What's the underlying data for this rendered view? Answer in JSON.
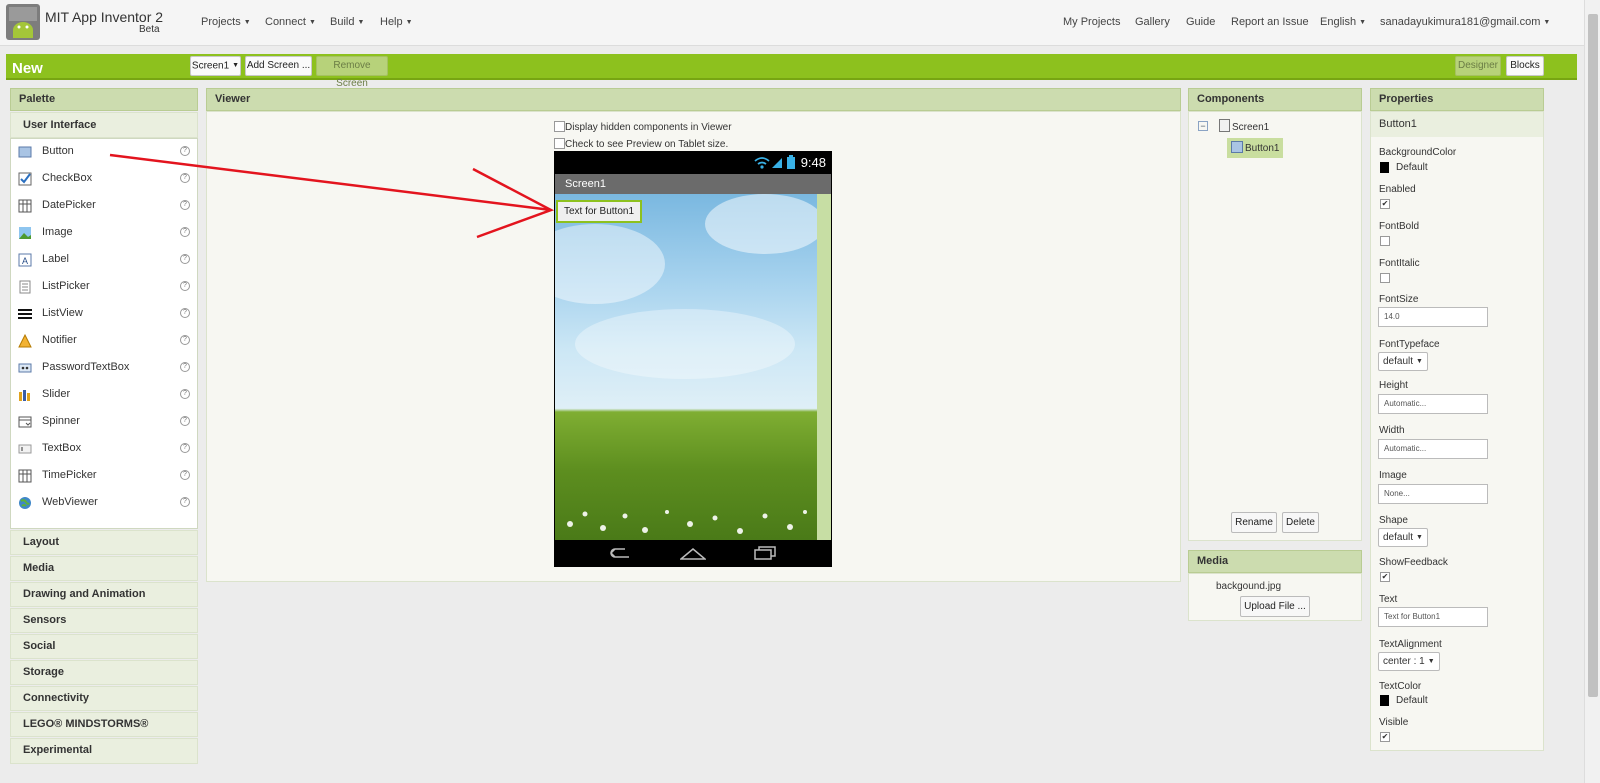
{
  "header": {
    "app_title": "MIT App Inventor 2",
    "app_subtitle": "Beta",
    "left_menu": [
      {
        "label": "Projects"
      },
      {
        "label": "Connect"
      },
      {
        "label": "Build"
      },
      {
        "label": "Help"
      }
    ],
    "right_menu": {
      "my_projects": "My Projects",
      "gallery": "Gallery",
      "guide": "Guide",
      "report": "Report an Issue",
      "language": "English",
      "account": "sanadayukimura181@gmail.com"
    }
  },
  "toolbar": {
    "project_name": "New",
    "screen_select": "Screen1",
    "add_screen": "Add Screen ...",
    "remove_screen": "Remove Screen",
    "designer": "Designer",
    "blocks": "Blocks"
  },
  "palette": {
    "title": "Palette",
    "open_category": "User Interface",
    "items": [
      {
        "label": "Button",
        "icon": "button-icon"
      },
      {
        "label": "CheckBox",
        "icon": "checkbox-icon"
      },
      {
        "label": "DatePicker",
        "icon": "datepicker-icon"
      },
      {
        "label": "Image",
        "icon": "image-icon"
      },
      {
        "label": "Label",
        "icon": "label-icon"
      },
      {
        "label": "ListPicker",
        "icon": "listpicker-icon"
      },
      {
        "label": "ListView",
        "icon": "listview-icon"
      },
      {
        "label": "Notifier",
        "icon": "notifier-icon"
      },
      {
        "label": "PasswordTextBox",
        "icon": "password-icon"
      },
      {
        "label": "Slider",
        "icon": "slider-icon"
      },
      {
        "label": "Spinner",
        "icon": "spinner-icon"
      },
      {
        "label": "TextBox",
        "icon": "textbox-icon"
      },
      {
        "label": "TimePicker",
        "icon": "timepicker-icon"
      },
      {
        "label": "WebViewer",
        "icon": "webviewer-icon"
      }
    ],
    "help_glyph": "?",
    "categories": [
      "Layout",
      "Media",
      "Drawing and Animation",
      "Sensors",
      "Social",
      "Storage",
      "Connectivity",
      "LEGO® MINDSTORMS®",
      "Experimental"
    ]
  },
  "viewer": {
    "title": "Viewer",
    "display_hidden": "Display hidden components in Viewer",
    "tablet_preview": "Check to see Preview on Tablet size.",
    "clock": "9:48",
    "screen_title": "Screen1",
    "button_text": "Text for Button1"
  },
  "components": {
    "title": "Components",
    "tree": {
      "screen": "Screen1",
      "child": "Button1"
    },
    "collapse_glyph": "−",
    "rename": "Rename",
    "delete": "Delete"
  },
  "media": {
    "title": "Media",
    "file": "backgound.jpg",
    "upload": "Upload File ..."
  },
  "properties": {
    "title": "Properties",
    "component": "Button1",
    "background_color_label": "BackgroundColor",
    "background_color_value": "Default",
    "enabled_label": "Enabled",
    "enabled": true,
    "fontbold_label": "FontBold",
    "fontbold": false,
    "fontitalic_label": "FontItalic",
    "fontitalic": false,
    "fontsize_label": "FontSize",
    "fontsize_value": "14.0",
    "typeface_label": "FontTypeface",
    "typeface_value": "default",
    "height_label": "Height",
    "height_value": "Automatic...",
    "width_label": "Width",
    "width_value": "Automatic...",
    "image_label": "Image",
    "image_value": "None...",
    "shape_label": "Shape",
    "shape_value": "default",
    "showfeedback_label": "ShowFeedback",
    "showfeedback": true,
    "text_label": "Text",
    "text_value": "Text for Button1",
    "textalign_label": "TextAlignment",
    "textalign_value": "center : 1",
    "textcolor_label": "TextColor",
    "textcolor_value": "Default",
    "visible_label": "Visible",
    "visible": true,
    "check_glyph": "✔"
  },
  "colors": {
    "brand_green": "#8dc11e",
    "panel_header": "#ccdcaf",
    "annotation_arrow": "#e3141e"
  }
}
